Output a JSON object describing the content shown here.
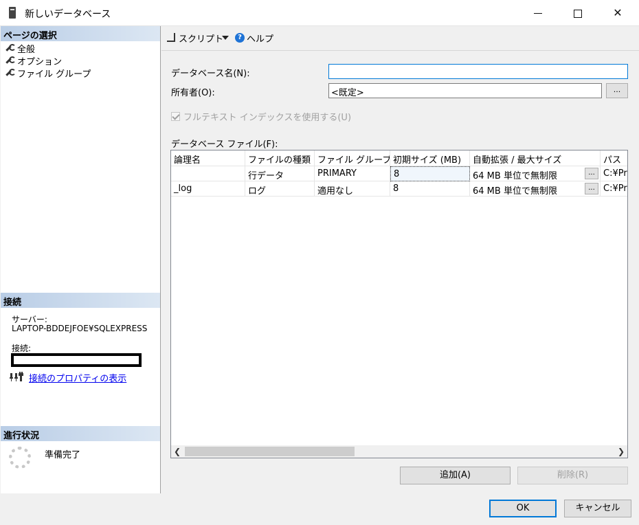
{
  "window": {
    "title": "新しいデータベース",
    "min_label": "",
    "close_label": "✕"
  },
  "left": {
    "page_select_header": "ページの選択",
    "nav": [
      {
        "label": "全般"
      },
      {
        "label": "オプション"
      },
      {
        "label": "ファイル グループ"
      }
    ],
    "connection_header": "接続",
    "server_label": "サーバー:",
    "server_value": "LAPTOP-BDDEJFOE¥SQLEXPRESS",
    "connection_label": "接続:",
    "connection_link": "接続のプロパティの表示",
    "progress_header": "進行状況",
    "progress_status": "準備完了"
  },
  "toolbar": {
    "script_label": "スクリプト",
    "help_label": "ヘルプ",
    "help_icon_text": "?"
  },
  "form": {
    "dbname_label": "データベース名(N):",
    "dbname_value": "",
    "owner_label": "所有者(O):",
    "owner_value": "<既定>",
    "fulltext_label": "フルテキスト インデックスを使用する(U)",
    "files_label": "データベース ファイル(F):",
    "ellipsis": "..."
  },
  "grid": {
    "columns": [
      "論理名",
      "ファイルの種類",
      "ファイル グループ",
      "初期サイズ (MB)",
      "自動拡張 / 最大サイズ",
      "パス"
    ],
    "rows": [
      {
        "logical": "",
        "type": "行データ",
        "group": "PRIMARY",
        "size": "8",
        "growth": "64 MB 単位で無制限",
        "path": "C:¥Pr"
      },
      {
        "logical": "_log",
        "type": "ログ",
        "group": "適用なし",
        "size": "8",
        "growth": "64 MB 単位で無制限",
        "path": "C:¥Pr"
      }
    ]
  },
  "buttons": {
    "add": "追加(A)",
    "delete": "削除(R)",
    "ok": "OK",
    "cancel": "キャンセル"
  }
}
